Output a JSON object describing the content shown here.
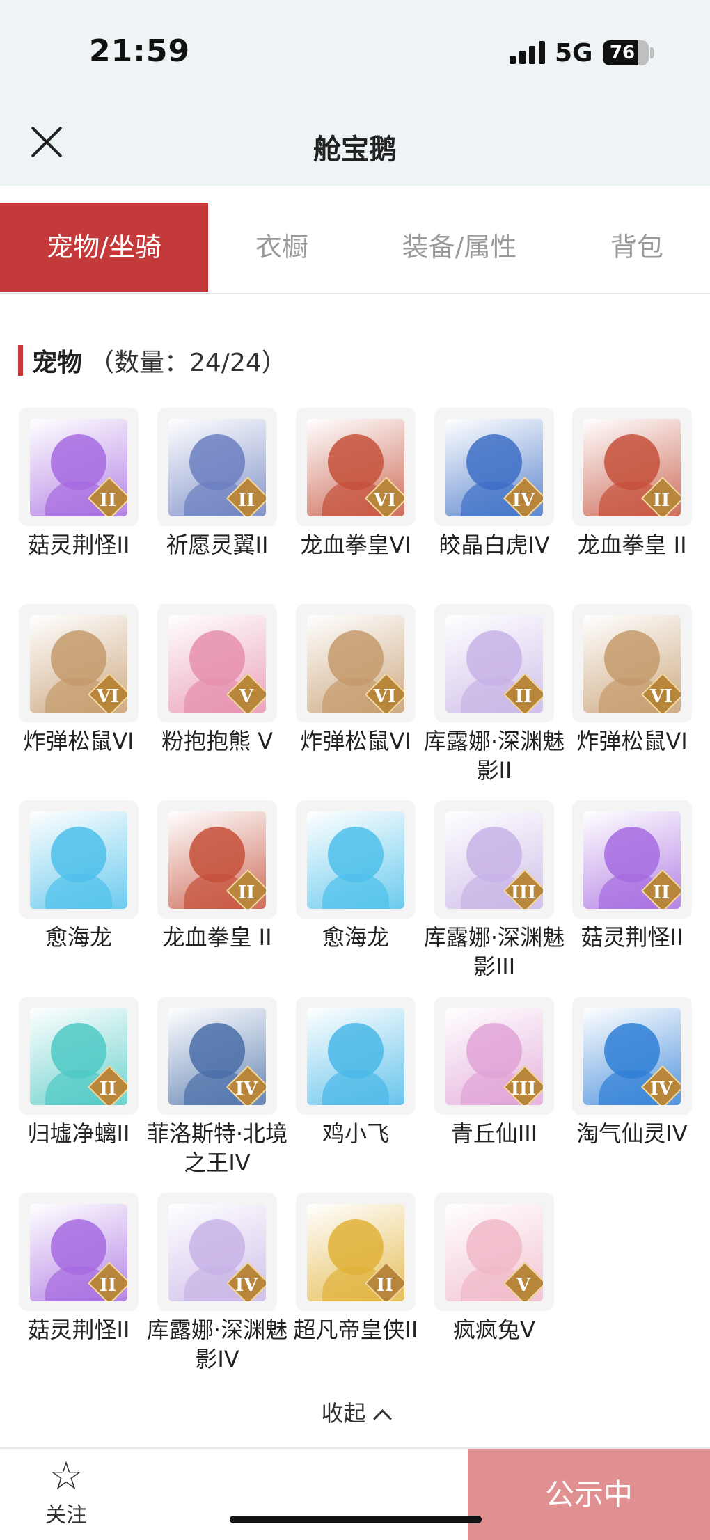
{
  "status": {
    "time": "21:59",
    "network": "5G",
    "battery": "76",
    "battery_level": 0.76
  },
  "nav": {
    "title": "舱宝鹅"
  },
  "tabs": [
    {
      "label": "宠物/坐骑",
      "active": true
    },
    {
      "label": "衣橱",
      "active": false
    },
    {
      "label": "装备/属性",
      "active": false
    },
    {
      "label": "背包",
      "active": false
    }
  ],
  "section": {
    "title": "宠物",
    "count": "（数量：24/24）"
  },
  "pets": [
    {
      "name": "菇灵荆怪II",
      "badge": "II",
      "color": "#a66be0"
    },
    {
      "name": "祈愿灵翼II",
      "badge": "II",
      "color": "#6b7fbf"
    },
    {
      "name": "龙血拳皇VI",
      "badge": "VI",
      "color": "#c4503a"
    },
    {
      "name": "皎晶白虎IV",
      "badge": "IV",
      "color": "#3d6fc6"
    },
    {
      "name": "龙血拳皇 II",
      "badge": "II",
      "color": "#c4503a"
    },
    {
      "name": "炸弹松鼠VI",
      "badge": "VI",
      "color": "#c49a6b"
    },
    {
      "name": "粉抱抱熊 V",
      "badge": "V",
      "color": "#e68fae"
    },
    {
      "name": "炸弹松鼠VI",
      "badge": "VI",
      "color": "#c49a6b"
    },
    {
      "name": "库露娜·深渊魅影II",
      "badge": "II",
      "color": "#c7b3e6"
    },
    {
      "name": "炸弹松鼠VI",
      "badge": "VI",
      "color": "#c49a6b"
    },
    {
      "name": "愈海龙",
      "badge": "",
      "color": "#4fc0ea"
    },
    {
      "name": "龙血拳皇 II",
      "badge": "II",
      "color": "#c4503a"
    },
    {
      "name": "愈海龙",
      "badge": "",
      "color": "#4fc0ea"
    },
    {
      "name": "库露娜·深渊魅影III",
      "badge": "III",
      "color": "#c7b3e6"
    },
    {
      "name": "菇灵荆怪II",
      "badge": "II",
      "color": "#a66be0"
    },
    {
      "name": "归墟净螭II",
      "badge": "II",
      "color": "#4fc9c4"
    },
    {
      "name": "菲洛斯特·北境之王IV",
      "badge": "IV",
      "color": "#4a6fa8"
    },
    {
      "name": "鸡小飞",
      "badge": "",
      "color": "#4ab8e8"
    },
    {
      "name": "青丘仙III",
      "badge": "III",
      "color": "#e0a3d6"
    },
    {
      "name": "淘气仙灵IV",
      "badge": "IV",
      "color": "#2f7fd6"
    },
    {
      "name": "菇灵荆怪II",
      "badge": "II",
      "color": "#a66be0"
    },
    {
      "name": "库露娜·深渊魅影IV",
      "badge": "IV",
      "color": "#c7b3e6"
    },
    {
      "name": "超凡帝皇侠II",
      "badge": "II",
      "color": "#e0b23a"
    },
    {
      "name": "疯疯兔V",
      "badge": "V",
      "color": "#f0b8c8"
    }
  ],
  "collapse_label": "收起",
  "bottom": {
    "follow_label": "关注",
    "public_label": "公示中"
  }
}
